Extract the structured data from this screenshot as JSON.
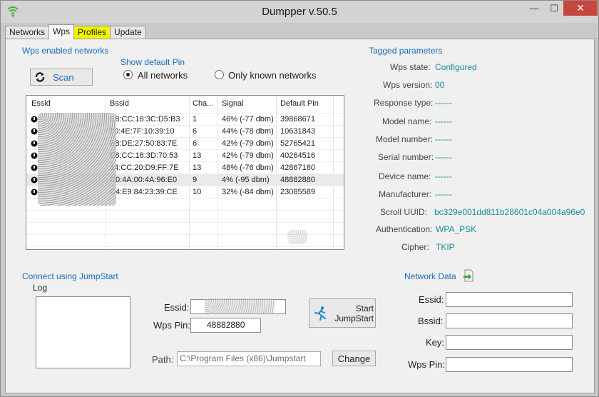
{
  "window": {
    "title": "Dumpper v.50.5",
    "min_glyph": "—",
    "max_glyph": "☐",
    "close_glyph": "✕"
  },
  "tabs": [
    "Networks",
    "Wps",
    "Profiles",
    "Update"
  ],
  "wps": {
    "section_title": "Wps enabled networks",
    "scan_label": "Scan",
    "show_default_pin": "Show default Pin",
    "radio_all": "All networks",
    "radio_known": "Only known networks",
    "columns": [
      "Essid",
      "Bssid",
      "Cha...",
      "Signal",
      "Default Pin"
    ],
    "rows": [
      {
        "essid": "",
        "bssid": "E8:CC:18:3C:D5:B3",
        "channel": "1",
        "signal": "46% (-77 dbm)",
        "pin": "39868671"
      },
      {
        "essid": "",
        "bssid": "20:4E:7F:10:39:10",
        "channel": "6",
        "signal": "44% (-78 dbm)",
        "pin": "10631843"
      },
      {
        "essid": "",
        "bssid": "E8:DE:27:50:83:7E",
        "channel": "6",
        "signal": "42% (-79 dbm)",
        "pin": "52765421"
      },
      {
        "essid": "",
        "bssid": "E8:CC:18:3D:70:53",
        "channel": "13",
        "signal": "42% (-79 dbm)",
        "pin": "40264516"
      },
      {
        "essid": "",
        "bssid": "14:CC:20:D9:FF:7E",
        "channel": "13",
        "signal": "48% (-76 dbm)",
        "pin": "42867180"
      },
      {
        "essid": "",
        "bssid": "C0:4A:00:4A:96:E0",
        "channel": "9",
        "signal": "4% (-95 dbm)",
        "pin": "48882880"
      },
      {
        "essid": "",
        "bssid": "C4:E9:84:23:39:CE",
        "channel": "10",
        "signal": "32% (-84 dbm)",
        "pin": "23085589"
      }
    ]
  },
  "tagged": {
    "title": "Tagged parameters",
    "wps_state_label": "Wps state:",
    "wps_state": "Configured",
    "wps_version_label": "Wps version:",
    "wps_version": "00",
    "response_type_label": "Response type:",
    "response_type": "------",
    "model_name_label": "Model name:",
    "model_name": "------",
    "model_number_label": "Model number:",
    "model_number": "------",
    "serial_number_label": "Serial number:",
    "serial_number": "------",
    "device_name_label": "Device name:",
    "device_name": "------",
    "manufacturer_label": "Manufacturer:",
    "manufacturer": "------",
    "scroll_uuid_label": "Scroll UUID:",
    "scroll_uuid": "bc329e001dd811b28601c04a004a96e0",
    "authentication_label": "Authentication:",
    "authentication": "WPA_PSK",
    "cipher_label": "Cipher:",
    "cipher": "TKIP"
  },
  "jumpstart": {
    "title": "Connect using JumpStart",
    "log_label": "Log",
    "essid_label": "Essid:",
    "essid_value": "",
    "wps_pin_label": "Wps Pin:",
    "wps_pin_value": "48882880",
    "start_label_1": "Start",
    "start_label_2": "JumpStart",
    "path_label": "Path:",
    "path_value": "C:\\Program Files (x86)\\Jumpstart",
    "change_label": "Change"
  },
  "network_data": {
    "title": "Network Data",
    "essid_label": "Essid:",
    "bssid_label": "Bssid:",
    "key_label": "Key:",
    "wps_pin_label": "Wps Pin:",
    "essid": "",
    "bssid": "",
    "key": "",
    "wps_pin": ""
  }
}
